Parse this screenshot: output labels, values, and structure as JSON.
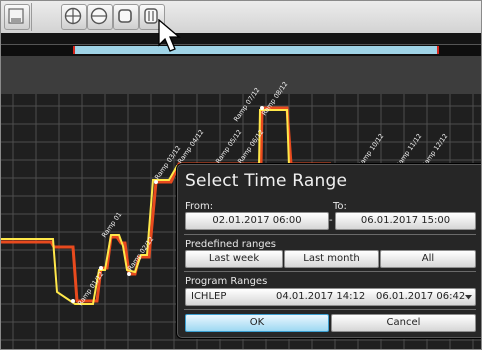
{
  "toolbar": {
    "icons": [
      "panel-icon",
      "zoom-in-icon",
      "zoom-out-icon",
      "fit-icon",
      "pan-icon"
    ]
  },
  "chart": {
    "ramp_labels": [
      "Ramp 01",
      "Ramp 02/12",
      "Ramp 03/12",
      "Ramp 04/12",
      "Ramp 05/12",
      "Ramp 06/12",
      "Ramp 07/12",
      "Ramp 08/12",
      "Ramp 10/12",
      "Ramp 11/12",
      "Ramp 12/12"
    ],
    "ramp_label_extra": "Ramp 01/12",
    "colors": {
      "series_a": "#ffe84a",
      "series_b": "#e84a1e",
      "grid": "#4d4d4d",
      "range": "#9fd3e6"
    }
  },
  "dialog": {
    "title": "Select Time Range",
    "from_label": "From:",
    "to_label": "To:",
    "dash": "-",
    "from_value": "02.01.2017 06:00",
    "to_value": "06.01.2017 15:00",
    "predefined_label": "Predefined ranges",
    "last_week": "Last week",
    "last_month": "Last month",
    "all": "All",
    "program_label": "Program Ranges",
    "program": {
      "name": "ICHLEP",
      "start": "04.01.2017 14:12",
      "end": "06.01.2017 06:42"
    },
    "ok": "OK",
    "cancel": "Cancel"
  }
}
